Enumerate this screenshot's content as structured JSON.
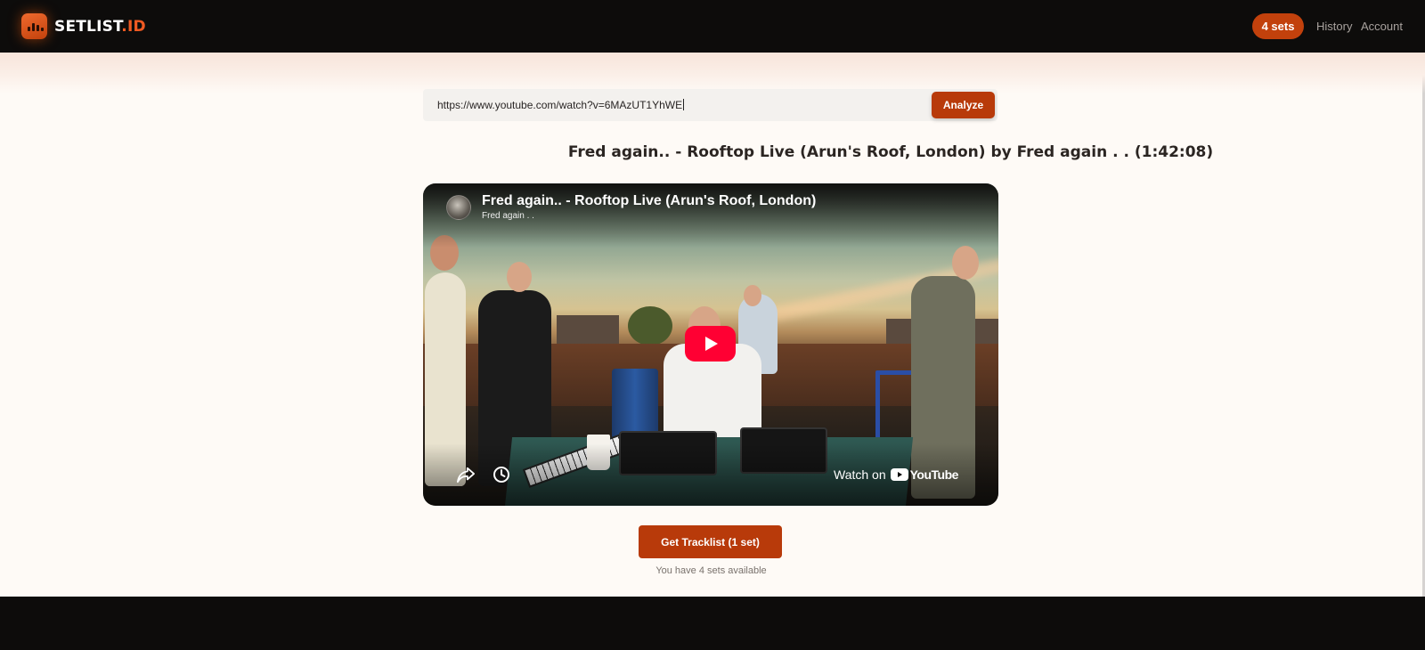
{
  "brand": {
    "name_main": "SETLIST",
    "name_accent": ".ID",
    "accent_color": "#f05a22"
  },
  "nav": {
    "sets_badge": "4 sets",
    "history": "History",
    "account": "Account"
  },
  "search": {
    "url_value": "https://www.youtube.com/watch?v=6MAzUT1YhWE",
    "analyze_label": "Analyze"
  },
  "video": {
    "heading": "Fred again.. - Rooftop Live (Arun's Roof, London) by Fred again . . (1:42:08)",
    "player_title": "Fred again.. - Rooftop Live (Arun's Roof, London)",
    "player_channel": "Fred again . .",
    "watch_on": "Watch on",
    "youtube_label": "YouTube"
  },
  "actions": {
    "get_tracklist_label": "Get Tracklist (1 set)",
    "sets_available_text": "You have 4 sets available"
  },
  "colors": {
    "primary_button": "#b83a0a",
    "header_bg": "#0d0c0b",
    "page_bg": "#fefaf6",
    "play_red": "#ff0033"
  }
}
